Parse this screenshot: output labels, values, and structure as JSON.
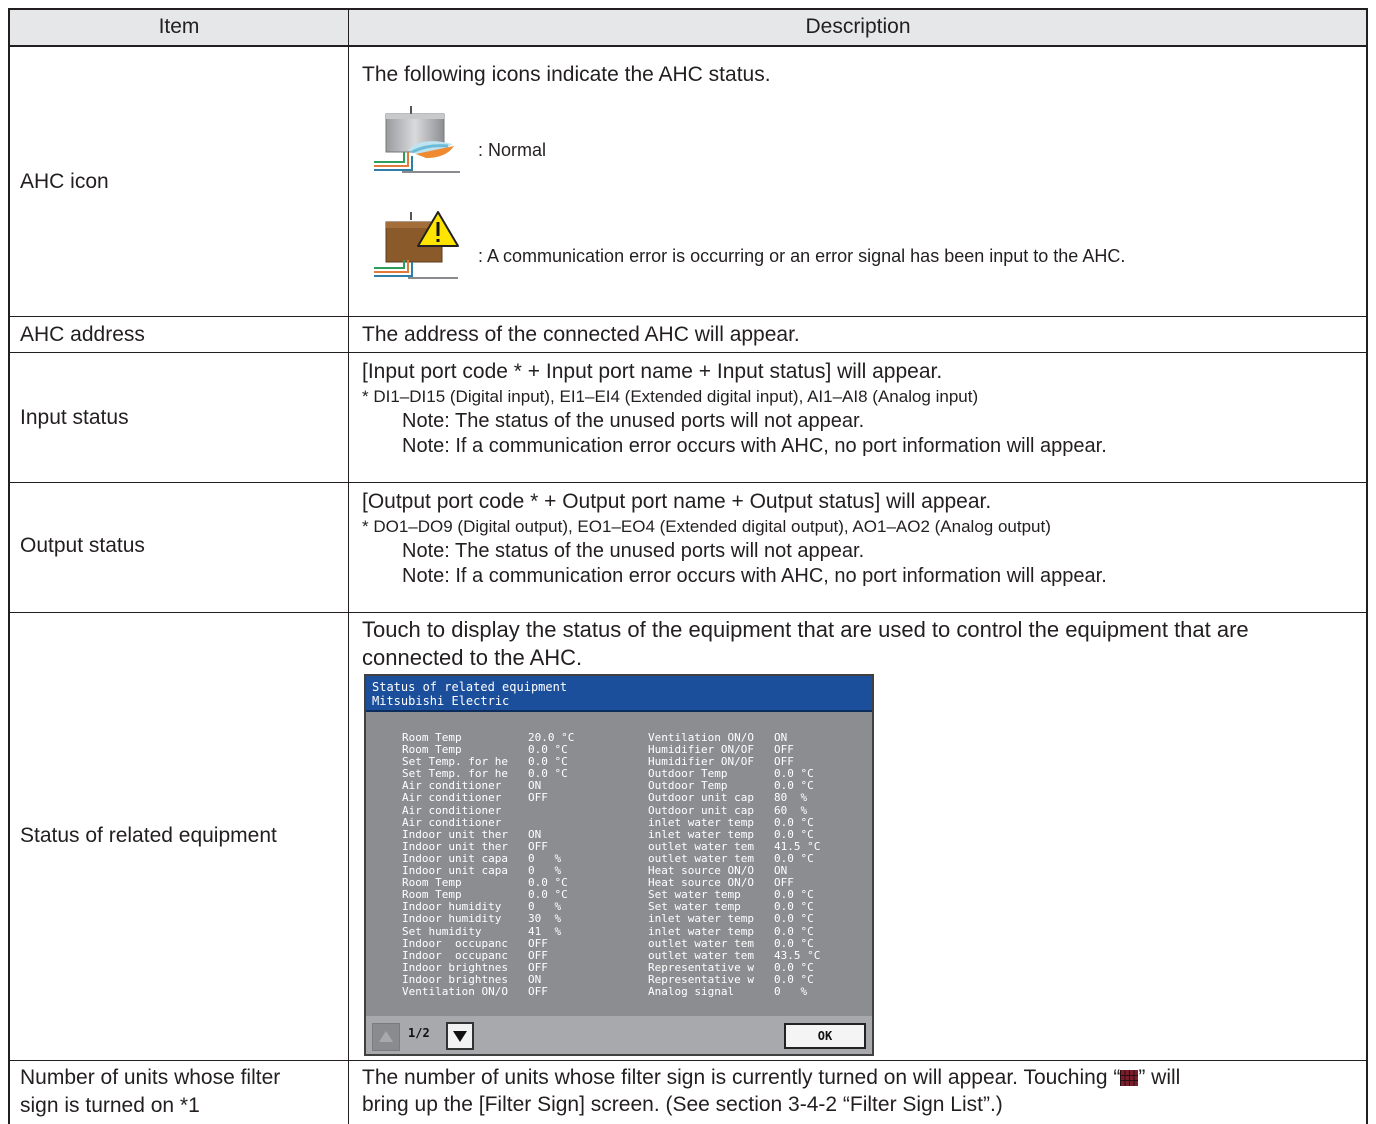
{
  "header": {
    "col_item": "Item",
    "col_description": "Description"
  },
  "rows": {
    "ahc_icon": {
      "item": "AHC icon",
      "intro": "The following icons indicate the AHC status.",
      "normal_caption": ": Normal",
      "error_caption": ": A communication error is occurring or an error signal has been input to the AHC."
    },
    "ahc_address": {
      "item": "AHC address",
      "line1": "The address of the connected AHC will appear."
    },
    "input_status": {
      "item": "Input status",
      "line1": "[Input port code * + Input port name + Input status] will appear.",
      "line2": "* DI1–DI15 (Digital input), EI1–EI4 (Extended digital input), AI1–AI8 (Analog input)",
      "line3": "Note: The status of the unused ports will not appear.",
      "line4": "Note: If a communication error occurs with AHC, no port information will appear."
    },
    "output_status": {
      "item": "Output status",
      "line1": "[Output port code * + Output port name + Output status] will appear.",
      "line2": "* DO1–DO9 (Digital output), EO1–EO4 (Extended digital output), AO1–AO2 (Analog output)",
      "line3": "Note: The status of the unused ports will not appear.",
      "line4": "Note: If a communication error occurs with AHC, no port information will appear."
    },
    "related_equipment": {
      "item": "Status of related equipment",
      "line1": "Touch to display the status of the equipment that are used to control the equipment that are",
      "line2": "connected to the AHC."
    },
    "filter_sign": {
      "item_line1": "Number of units whose filter",
      "item_line2": "sign is turned on *1",
      "line1_a": "The number of units whose filter sign is currently turned on will appear. Touching “",
      "line1_b": "” will",
      "line2": "bring up the [Filter Sign] screen. (See section 3-4-2 “Filter Sign List”.)"
    }
  },
  "dialog": {
    "title_line1": "Status of related equipment",
    "title_line2": "Mitsubishi Electric",
    "left_rows": [
      {
        "label": "Room Temp",
        "value": "20.0 °C"
      },
      {
        "label": "Room Temp",
        "value": "0.0 °C"
      },
      {
        "label": "Set Temp. for he",
        "value": "0.0 °C"
      },
      {
        "label": "Set Temp. for he",
        "value": "0.0 °C"
      },
      {
        "label": "Air conditioner",
        "value": "ON"
      },
      {
        "label": "Air conditioner",
        "value": "OFF"
      },
      {
        "label": "Air conditioner",
        "value": ""
      },
      {
        "label": "Air conditioner",
        "value": ""
      },
      {
        "label": "Indoor unit ther",
        "value": "ON"
      },
      {
        "label": "Indoor unit ther",
        "value": "OFF"
      },
      {
        "label": "Indoor unit capa",
        "value": "0   %"
      },
      {
        "label": "Indoor unit capa",
        "value": "0   %"
      },
      {
        "label": "Room Temp",
        "value": "0.0 °C"
      },
      {
        "label": "Room Temp",
        "value": "0.0 °C"
      },
      {
        "label": "Indoor humidity",
        "value": "0   %"
      },
      {
        "label": "Indoor humidity",
        "value": "30  %"
      },
      {
        "label": "Set humidity",
        "value": "41  %"
      },
      {
        "label": "Indoor  occupanc",
        "value": "OFF"
      },
      {
        "label": "Indoor  occupanc",
        "value": "OFF"
      },
      {
        "label": "Indoor brightnes",
        "value": "OFF"
      },
      {
        "label": "Indoor brightnes",
        "value": "ON"
      },
      {
        "label": "Ventilation ON/O",
        "value": "OFF"
      }
    ],
    "right_rows": [
      {
        "label": "Ventilation ON/O",
        "value": "ON"
      },
      {
        "label": "Humidifier ON/OF",
        "value": "OFF"
      },
      {
        "label": "Humidifier ON/OF",
        "value": "OFF"
      },
      {
        "label": "Outdoor Temp",
        "value": "0.0 °C"
      },
      {
        "label": "Outdoor Temp",
        "value": "0.0 °C"
      },
      {
        "label": "Outdoor unit cap",
        "value": "80  %"
      },
      {
        "label": "Outdoor unit cap",
        "value": "60  %"
      },
      {
        "label": "inlet water temp",
        "value": "0.0 °C"
      },
      {
        "label": "inlet water temp",
        "value": "0.0 °C"
      },
      {
        "label": "outlet water tem",
        "value": "41.5 °C"
      },
      {
        "label": "outlet water tem",
        "value": "0.0 °C"
      },
      {
        "label": "Heat source ON/O",
        "value": "ON"
      },
      {
        "label": "Heat source ON/O",
        "value": "OFF"
      },
      {
        "label": "Set water temp",
        "value": "0.0 °C"
      },
      {
        "label": "Set water temp",
        "value": "0.0 °C"
      },
      {
        "label": "inlet water temp",
        "value": "0.0 °C"
      },
      {
        "label": "inlet water temp",
        "value": "0.0 °C"
      },
      {
        "label": "outlet water tem",
        "value": "0.0 °C"
      },
      {
        "label": "outlet water tem",
        "value": "43.5 °C"
      },
      {
        "label": "Representative w",
        "value": "0.0 °C"
      },
      {
        "label": "Representative w",
        "value": "0.0 °C"
      },
      {
        "label": "Analog signal",
        "value": "0   %"
      }
    ],
    "page_indicator": "1/2",
    "ok_label": "OK",
    "up_icon": "triangle-up-icon",
    "down_icon": "triangle-down-icon"
  },
  "icons": {
    "normal": "ahc-normal-icon",
    "error": "ahc-error-icon",
    "filter": "filter-sign-icon"
  },
  "colors": {
    "header_bg": "#e6e7e8",
    "dialog_title_bg": "#1b4f9c",
    "dialog_body_bg": "#8c8d91"
  }
}
